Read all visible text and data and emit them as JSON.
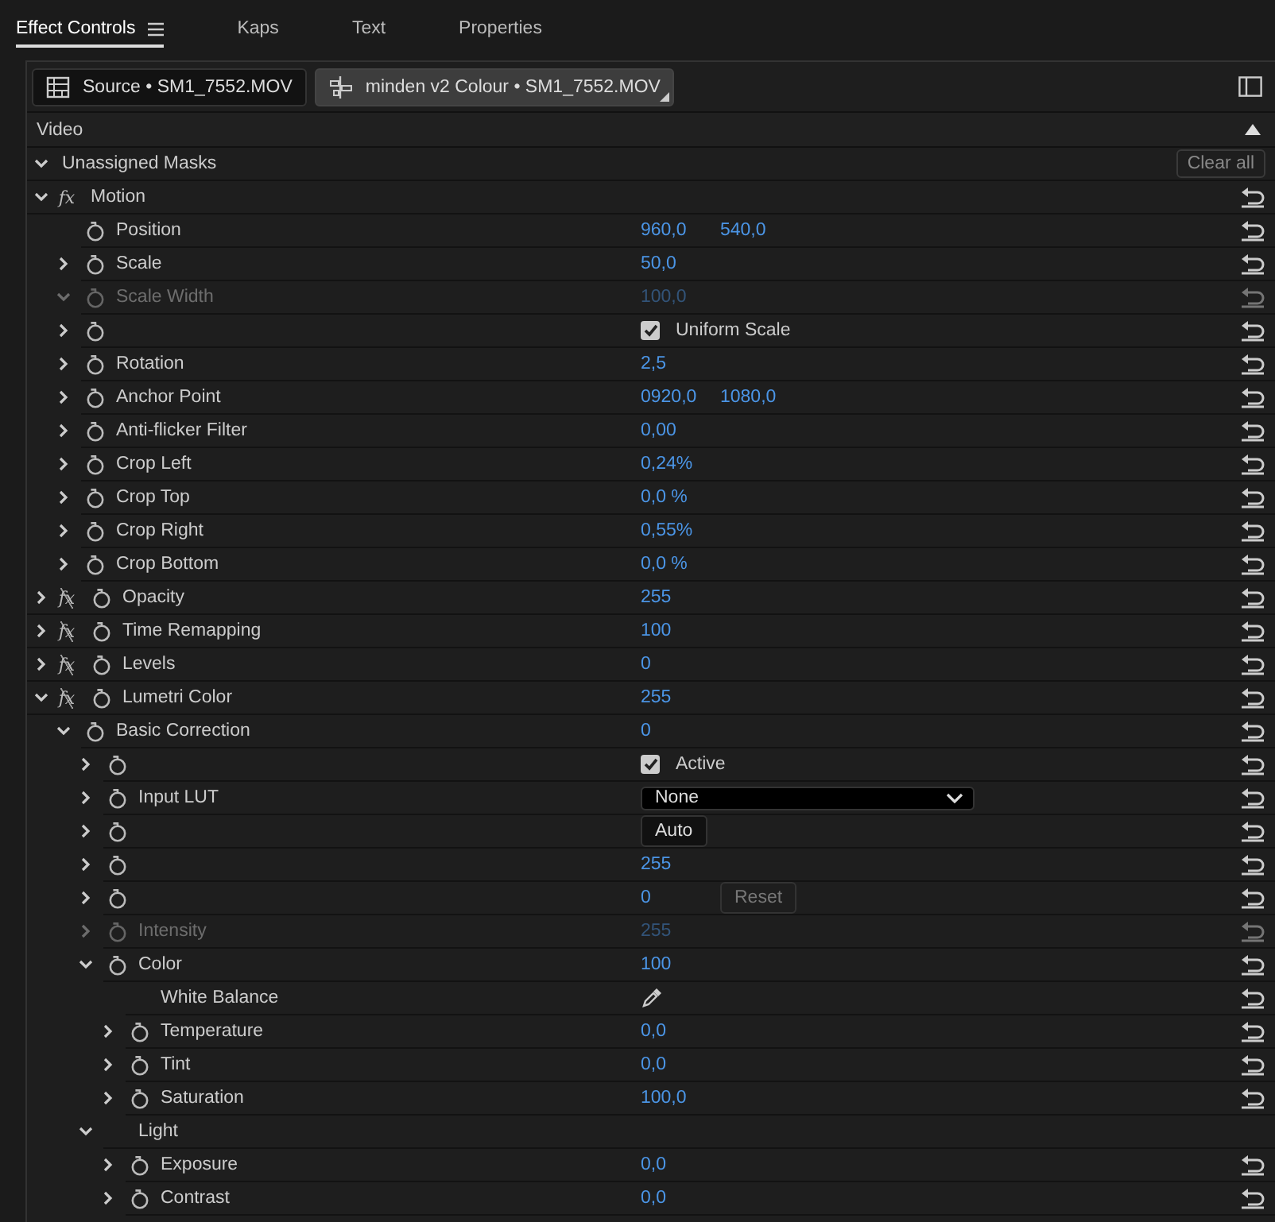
{
  "tabs": [
    {
      "label": "Effect Controls",
      "selected": true,
      "menu": true
    },
    {
      "label": "Kaps",
      "selected": false
    },
    {
      "label": "Text",
      "selected": false
    },
    {
      "label": "Properties",
      "selected": false
    }
  ],
  "source_tabs": [
    {
      "kind": "source",
      "label": "Source • SM1_7552.MOV",
      "selected": false
    },
    {
      "kind": "sequence",
      "label": "minden v2 Colour • SM1_7552.MOV",
      "selected": true
    }
  ],
  "section": {
    "label": "Video"
  },
  "masks": {
    "label": "Unassigned Masks",
    "expanded": true,
    "button": "Clear all"
  },
  "effects": [
    {
      "label": "Motion",
      "expanded": true,
      "fx": "fx",
      "fx_on": true,
      "reset": true,
      "children": [
        {
          "label": "Position",
          "stopwatch": true,
          "kind": "value",
          "values": [
            "960,0",
            "540,0"
          ],
          "reset": true
        },
        {
          "label": "Scale",
          "expanded": false,
          "stopwatch": true,
          "kind": "value",
          "values": [
            "50,0"
          ],
          "reset": true
        },
        {
          "label": "Scale Width",
          "expanded": true,
          "stopwatch": true,
          "disabled": true,
          "kind": "value",
          "values": [
            "100,0"
          ],
          "reset": true
        },
        {
          "expanded": false,
          "stopwatch": true,
          "kind": "checkbox",
          "checked": true,
          "option": "Uniform Scale",
          "reset": true
        },
        {
          "label": "Rotation",
          "expanded": false,
          "stopwatch": true,
          "kind": "value",
          "values": [
            "2,5"
          ],
          "reset": true
        },
        {
          "label": "Anchor Point",
          "expanded": false,
          "stopwatch": true,
          "kind": "value",
          "values": [
            "0920,0",
            "1080,0"
          ],
          "reset": true
        },
        {
          "label": "Anti-flicker Filter",
          "expanded": false,
          "stopwatch": true,
          "kind": "value",
          "values": [
            "0,00"
          ],
          "reset": true
        },
        {
          "label": "Crop Left",
          "expanded": false,
          "stopwatch": true,
          "kind": "value",
          "values": [
            "0,24%"
          ],
          "reset": true
        },
        {
          "label": "Crop Top",
          "expanded": false,
          "stopwatch": true,
          "kind": "value",
          "values": [
            "0,0 %"
          ],
          "reset": true
        },
        {
          "label": "Crop Right",
          "expanded": false,
          "stopwatch": true,
          "kind": "value",
          "values": [
            "0,55%"
          ],
          "reset": true
        },
        {
          "label": "Crop Bottom",
          "expanded": false,
          "stopwatch": true,
          "kind": "value",
          "values": [
            "0,0 %"
          ],
          "reset": true
        }
      ]
    },
    {
      "label": "Opacity",
      "expanded": false,
      "fx": "fx",
      "fx_on": false,
      "stopwatch": true,
      "kind": "value",
      "values": [
        "255"
      ],
      "reset": true
    },
    {
      "label": "Time Remapping",
      "expanded": false,
      "fx": "fx",
      "fx_on": false,
      "stopwatch": true,
      "kind": "value",
      "values": [
        "100"
      ],
      "reset": true
    },
    {
      "label": "Levels",
      "expanded": false,
      "fx": "fx",
      "fx_on": false,
      "stopwatch": true,
      "kind": "value",
      "values": [
        "0"
      ],
      "reset": true
    },
    {
      "label": "Lumetri Color",
      "expanded": true,
      "fx": "fx",
      "fx_on": false,
      "stopwatch": true,
      "kind": "value",
      "values": [
        "255"
      ],
      "reset": true,
      "children": [
        {
          "label": "Basic Correction",
          "expanded": true,
          "stopwatch": true,
          "kind": "value",
          "values": [
            "0"
          ],
          "reset": true,
          "children": [
            {
              "expanded": false,
              "stopwatch": true,
              "kind": "checkbox",
              "checked": true,
              "option": "Active",
              "reset": true
            },
            {
              "label": "Input LUT",
              "expanded": false,
              "stopwatch": true,
              "kind": "dropdown",
              "option": "None",
              "reset": true
            },
            {
              "expanded": false,
              "stopwatch": true,
              "kind": "button",
              "button": "Auto",
              "button_disabled": false,
              "reset": true
            },
            {
              "expanded": false,
              "stopwatch": true,
              "kind": "value",
              "values": [
                "255"
              ],
              "reset": true
            },
            {
              "expanded": false,
              "stopwatch": true,
              "kind": "value",
              "values": [
                "0"
              ],
              "button": "Reset",
              "button_disabled": true,
              "reset": true
            },
            {
              "label": "Intensity",
              "expanded": false,
              "stopwatch": true,
              "disabled": true,
              "kind": "value",
              "values": [
                "255"
              ],
              "reset": true
            },
            {
              "label": "Color",
              "expanded": true,
              "stopwatch": true,
              "kind": "value",
              "values": [
                "100"
              ],
              "reset": true,
              "children": [
                {
                  "label": "White Balance",
                  "kind": "eyedropper",
                  "reset": true
                },
                {
                  "label": "Temperature",
                  "expanded": false,
                  "stopwatch": true,
                  "kind": "value",
                  "values": [
                    "0,0"
                  ],
                  "reset": true
                },
                {
                  "label": "Tint",
                  "expanded": false,
                  "stopwatch": true,
                  "kind": "value",
                  "values": [
                    "0,0"
                  ],
                  "reset": true
                },
                {
                  "label": "Saturation",
                  "expanded": false,
                  "stopwatch": true,
                  "kind": "value",
                  "values": [
                    "100,0"
                  ],
                  "reset": true
                }
              ]
            },
            {
              "label": "Light",
              "expanded": true,
              "kind": "none",
              "reset": false,
              "children": [
                {
                  "label": "Exposure",
                  "expanded": false,
                  "stopwatch": true,
                  "kind": "value",
                  "values": [
                    "0,0"
                  ],
                  "reset": true
                },
                {
                  "label": "Contrast",
                  "expanded": false,
                  "stopwatch": true,
                  "kind": "value",
                  "values": [
                    "0,0"
                  ],
                  "reset": true
                }
              ]
            }
          ]
        }
      ]
    }
  ]
}
